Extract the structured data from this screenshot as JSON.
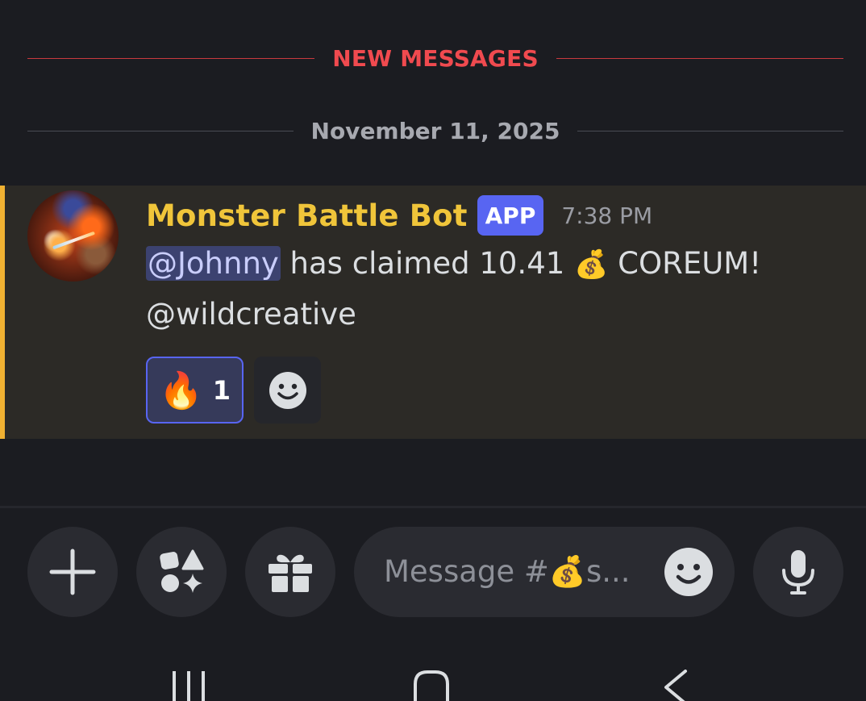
{
  "dividers": {
    "new_messages": "NEW MESSAGES",
    "date": "November 11, 2025"
  },
  "message": {
    "author": "Monster Battle Bot",
    "app_tag": "APP",
    "timestamp": "7:38 PM",
    "mention": "@Johnny",
    "text_before_emoji": " has claimed 10.41 ",
    "money_bag_emoji": "💰",
    "text_after_emoji": " COREUM!",
    "second_line": "@wildcreative",
    "avatar_icon": "monster-battle-avatar-icon",
    "reactions": [
      {
        "emoji": "🔥",
        "count": "1",
        "active": true
      }
    ],
    "add_reaction_icon": "smiley-icon"
  },
  "composer": {
    "placeholder": "Message #💰s...",
    "buttons": {
      "plus_icon": "plus-icon",
      "apps_icon": "apps-icon",
      "gift_icon": "gift-icon",
      "emoji_icon": "smiley-icon",
      "mic_icon": "microphone-icon"
    }
  },
  "navbar": {
    "recents_icon": "recents-icon",
    "home_icon": "home-icon",
    "back_icon": "back-icon"
  },
  "colors": {
    "background": "#1b1c21",
    "new_messages": "#f04a4f",
    "author": "#f0c53a",
    "app_tag": "#5865f2",
    "mention_highlight": "#2c2a26",
    "mention_bar": "#f0b132"
  }
}
